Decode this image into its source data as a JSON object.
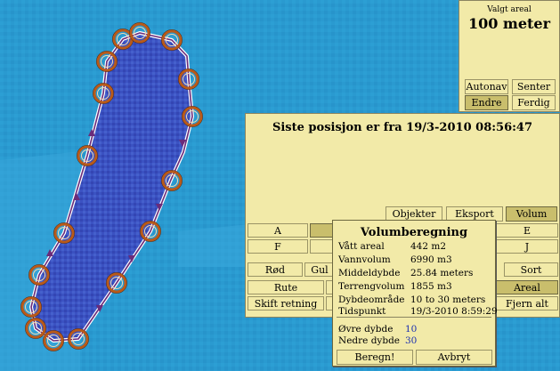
{
  "colors": {
    "water": "#2a9ad0",
    "polygon_fill": "#3a4fbf",
    "polygon_line": "#6a2b7a",
    "marker": "#b85a1a",
    "panel": "#f2eaa8",
    "selected_button": "#c9be6c",
    "depth_value": "#1a2fb0"
  },
  "area_panel": {
    "caption": "Valgt areal",
    "value": "100 meter",
    "buttons": [
      {
        "label": "Autonav",
        "selected": false
      },
      {
        "label": "Senter",
        "selected": false
      },
      {
        "label": "Endre",
        "selected": true
      },
      {
        "label": "Ferdig",
        "selected": false
      }
    ]
  },
  "position_panel": {
    "title": "Siste posisjon er fra 19/3-2010 08:56:47",
    "tabs": [
      {
        "label": "Objekter",
        "selected": false
      },
      {
        "label": "Eksport",
        "selected": false
      },
      {
        "label": "Volum",
        "selected": true
      }
    ],
    "grid_buttons": {
      "a": "A",
      "e": "E",
      "f": "F",
      "j": "J",
      "rod": "Rød",
      "gul": "Gul",
      "sort": "Sort",
      "rute": "Rute",
      "areal": "Areal",
      "skift_retning": "Skift retning",
      "fjern_alt": "Fjern alt"
    }
  },
  "volume_dialog": {
    "title": "Volumberegning",
    "rows": [
      {
        "label": "Vått areal",
        "value": "442 m2"
      },
      {
        "label": "Vannvolum",
        "value": "6990 m3"
      },
      {
        "label": "Middeldybde",
        "value": "25.84 meters"
      },
      {
        "label": "Terrengvolum",
        "value": "1855 m3"
      },
      {
        "label": "Dybdeområde",
        "value": "10 to 30 meters"
      },
      {
        "label": "Tidspunkt",
        "value": "19/3-2010 8:59:29"
      }
    ],
    "upper_depth_label": "Øvre dybde",
    "upper_depth_value": "10",
    "lower_depth_label": "Nedre dybde",
    "lower_depth_value": "30",
    "calculate_button": "Beregn!",
    "cancel_button": "Avbryt"
  }
}
